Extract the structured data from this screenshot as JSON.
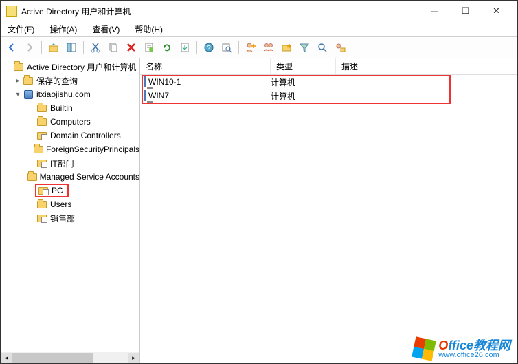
{
  "window": {
    "title": "Active Directory 用户和计算机"
  },
  "menu": {
    "file": "文件(F)",
    "action": "操作(A)",
    "view": "查看(V)",
    "help": "帮助(H)"
  },
  "tree": {
    "root": "Active Directory 用户和计算机",
    "saved_queries": "保存的查询",
    "domain": "itxiaojishu.com",
    "nodes": {
      "builtin": "Builtin",
      "computers": "Computers",
      "domain_controllers": "Domain Controllers",
      "foreign": "ForeignSecurityPrincipals",
      "itdept": "IT部门",
      "msa": "Managed Service Accounts",
      "pc": "PC",
      "users": "Users",
      "sales": "销售部"
    }
  },
  "list": {
    "columns": {
      "name": "名称",
      "type": "类型",
      "desc": "描述"
    },
    "rows": [
      {
        "name": "WIN10-1",
        "type": "计算机"
      },
      {
        "name": "WIN7",
        "type": "计算机"
      }
    ]
  },
  "watermark": {
    "brand_prefix": "O",
    "brand_rest": "ffice教程网",
    "url": "www.office26.com"
  }
}
